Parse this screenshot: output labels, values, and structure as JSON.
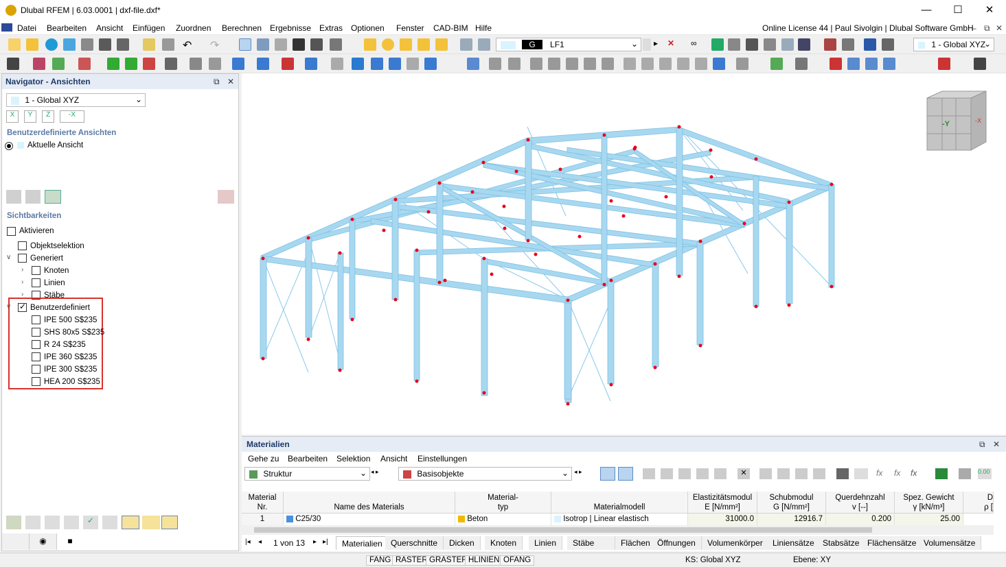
{
  "window": {
    "title": "Dlubal RFEM | 6.03.0001 | dxf-file.dxf*",
    "minimize": "—",
    "maximize": "☐",
    "close": "✕"
  },
  "menu": [
    "Datei",
    "Bearbeiten",
    "Ansicht",
    "Einfügen",
    "Zuordnen",
    "Berechnen",
    "Ergebnisse",
    "Extras",
    "Optionen",
    "Fenster",
    "CAD-BIM",
    "Hilfe"
  ],
  "license": "Online License 44 | Paul Sivolgin | Dlubal Software GmbH",
  "toolbar": {
    "loadcase_type": "G",
    "loadcase": "LF1",
    "view_combo": "1 - Global XYZ"
  },
  "navigator": {
    "title": "Navigator - Ansichten",
    "view_combo": "1 - Global XYZ",
    "axis_buttons": [
      "X",
      "Y",
      "Z",
      "-X"
    ],
    "section_custom_views": "Benutzerdefinierte Ansichten",
    "current_view": "Aktuelle Ansicht",
    "section_visibility": "Sichtbarkeiten",
    "items": {
      "activate": "Aktivieren",
      "object_selection": "Objektselektion",
      "generated": "Generiert",
      "nodes": "Knoten",
      "lines": "Linien",
      "members": "Stäbe",
      "user_defined": "Benutzerdefiniert"
    },
    "sections": [
      "IPE 500 S$235",
      "SHS 80x5 S$235",
      "R 24 S$235",
      "IPE 360 S$235",
      "IPE 300 S$235",
      "HEA 200 S$235"
    ]
  },
  "materials": {
    "title": "Materialien",
    "menu": [
      "Gehe zu",
      "Bearbeiten",
      "Selektion",
      "Ansicht",
      "Einstellungen"
    ],
    "combo_left": "Struktur",
    "combo_right": "Basisobjekte",
    "columns": [
      {
        "l1": "Material",
        "l2": "Nr."
      },
      {
        "l1": "",
        "l2": "Name des Materials"
      },
      {
        "l1": "Material-",
        "l2": "typ"
      },
      {
        "l1": "",
        "l2": "Materialmodell"
      },
      {
        "l1": "Elastizitätsmodul",
        "l2": "E [N/mm²]"
      },
      {
        "l1": "Schubmodul",
        "l2": "G [N/mm²]"
      },
      {
        "l1": "Querdehnzahl",
        "l2": "v [--]"
      },
      {
        "l1": "Spez. Gewicht",
        "l2": "γ [kN/m³]"
      },
      {
        "l1": "D",
        "l2": "ρ ["
      }
    ],
    "rows": [
      {
        "nr": "1",
        "name": "C25/30",
        "type": "Beton",
        "model": "Isotrop | Linear elastisch",
        "e": "31000.0",
        "g": "12916.7",
        "v": "0.200",
        "gamma": "25.00"
      }
    ],
    "pager": "1 von 13",
    "tabs": [
      "Materialien",
      "Querschnitte",
      "Dicken",
      "Knoten",
      "Linien",
      "Stäbe",
      "Flächen",
      "Öffnungen",
      "Volumenkörper",
      "Liniensätze",
      "Stabsätze",
      "Flächensätze",
      "Volumensätze"
    ]
  },
  "status": {
    "items": [
      "FANG",
      "RASTER",
      "GRASTER",
      "HLINIEN",
      "OFANG"
    ],
    "cs": "KS: Global XYZ",
    "plane": "Ebene: XY"
  },
  "viewcube": {
    "y": "-Y",
    "x": "-X"
  },
  "colors": {
    "member": "#a8d8f0",
    "member_edge": "#7cc0e4",
    "node": "#e8001c",
    "highlight_box": "#d9302c"
  }
}
